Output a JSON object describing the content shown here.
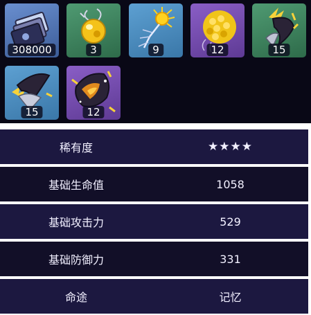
{
  "items": [
    {
      "name": "Credit",
      "count": "308000",
      "bg": "#4d6fa8"
    },
    {
      "name": "Gold Sphere",
      "count": "3",
      "bg": "#3d8a62"
    },
    {
      "name": "Neural Fragment",
      "count": "9",
      "bg": "#4d8fc2"
    },
    {
      "name": "Golden Cluster",
      "count": "12",
      "bg": "#7c4fb6"
    },
    {
      "name": "Dark Crown Shard",
      "count": "15",
      "bg": "#3d8a62"
    },
    {
      "name": "Dark Crown Blade",
      "count": "15",
      "bg": "#4d8fc2"
    },
    {
      "name": "Dark Crown Core",
      "count": "12",
      "bg": "#7c4fb6"
    }
  ],
  "stats": [
    {
      "label": "稀有度",
      "value": "★★★★"
    },
    {
      "label": "基础生命值",
      "value": "1058"
    },
    {
      "label": "基础攻击力",
      "value": "529"
    },
    {
      "label": "基础防御力",
      "value": "331"
    },
    {
      "label": "命途",
      "value": "记忆"
    }
  ]
}
